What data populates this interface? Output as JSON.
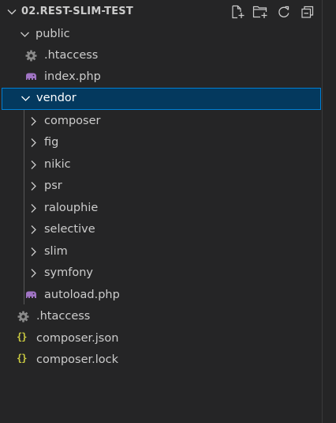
{
  "explorer": {
    "title": "02.REST-SLIM-TEST",
    "actions": [
      "new-file-icon",
      "new-folder-icon",
      "refresh-icon",
      "collapse-all-icon"
    ]
  },
  "tree": {
    "public": {
      "label": "public",
      "icon": "chevron-down-icon"
    },
    "public_htaccess": {
      "label": ".htaccess",
      "icon": "gear-icon"
    },
    "public_index": {
      "label": "index.php",
      "icon": "php-elephant-icon"
    },
    "vendor": {
      "label": "vendor",
      "icon": "chevron-down-icon",
      "selected": true
    },
    "vendor_children": [
      {
        "label": "composer"
      },
      {
        "label": "fig"
      },
      {
        "label": "nikic"
      },
      {
        "label": "psr"
      },
      {
        "label": "ralouphie"
      },
      {
        "label": "selective"
      },
      {
        "label": "slim"
      },
      {
        "label": "symfony"
      }
    ],
    "autoload": {
      "label": "autoload.php",
      "icon": "php-elephant-icon"
    },
    "root_htaccess": {
      "label": ".htaccess",
      "icon": "gear-icon"
    },
    "composer_json": {
      "label": "composer.json",
      "icon": "json-braces-icon"
    },
    "composer_lock": {
      "label": "composer.lock",
      "icon": "json-braces-icon"
    }
  },
  "colors": {
    "background": "#252526",
    "text": "#cccccc",
    "selection_bg": "#04395e",
    "selection_border": "#007fd4",
    "php_icon": "#a074c4",
    "json_icon": "#cbcb41",
    "gear_icon": "#8a8a8a"
  }
}
